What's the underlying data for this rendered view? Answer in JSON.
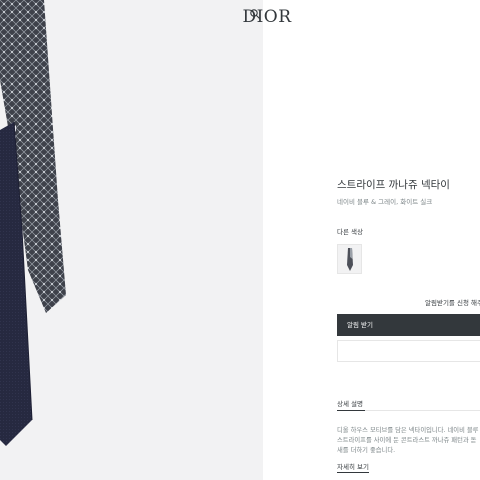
{
  "header": {
    "logo_text": "DIOR",
    "search_icon": "search-icon"
  },
  "product": {
    "title": "스트라이프 까나쥬 넥타이",
    "subtitle": "네이비 블루 & 그레이, 화이트 실크",
    "other_colors_label": "다른 색상",
    "notify_note": "알림받기를 신청 해주세요",
    "notify_button_label": "알림 받기",
    "description_tab_label": "상세 설명",
    "description_lines": [
      "디올 하우스 모티브를 담은 넥타이입니다. 네이비 블루",
      "스트라이프를 사이에 둔 콘트라스트 까나쥬 패턴과 돋",
      "새를 더하기 좋습니다."
    ],
    "more_link_label": "자세히 보기"
  },
  "colors": {
    "background_left": "#f2f2f3",
    "navy": "#272a45",
    "grey_pattern": "#4d5059",
    "text_primary": "#33383c",
    "text_secondary": "#7b8487",
    "button_dark": "#33383c"
  }
}
